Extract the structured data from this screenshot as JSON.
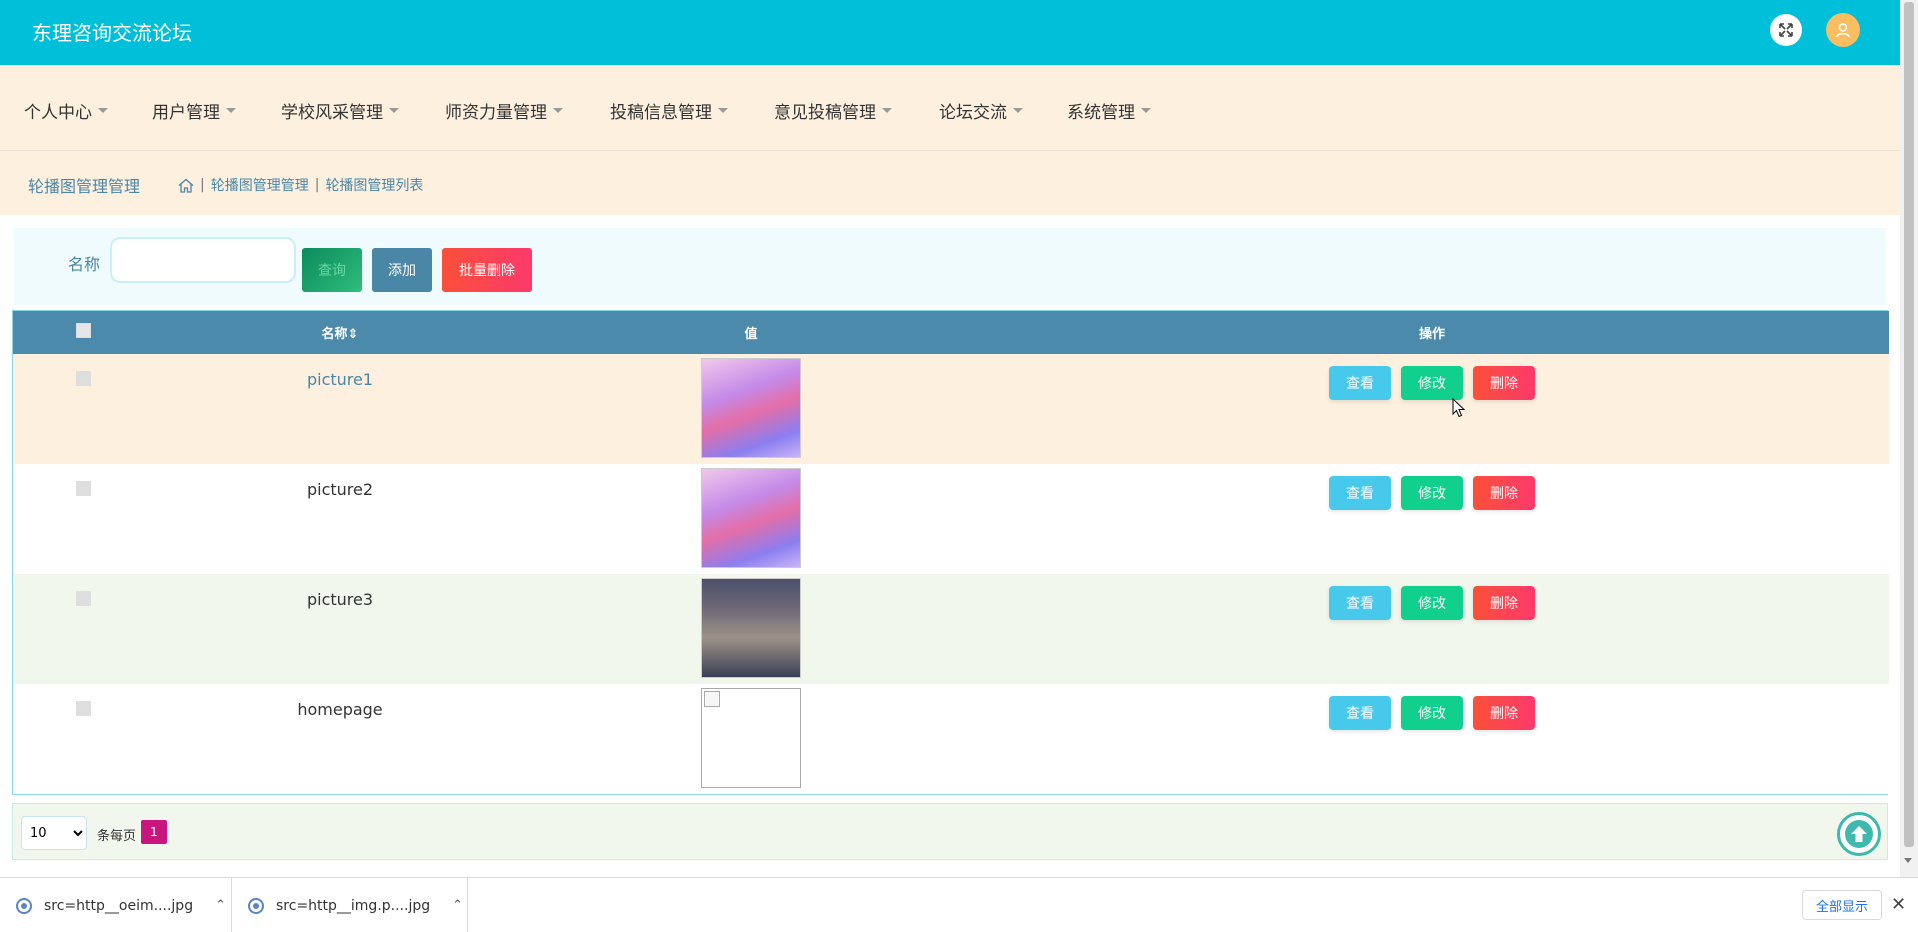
{
  "header": {
    "site_title": "东理咨询交流论坛"
  },
  "nav": {
    "items": [
      {
        "label": "个人中心"
      },
      {
        "label": "用户管理"
      },
      {
        "label": "学校风采管理"
      },
      {
        "label": "师资力量管理"
      },
      {
        "label": "投稿信息管理"
      },
      {
        "label": "意见投稿管理"
      },
      {
        "label": "论坛交流"
      },
      {
        "label": "系统管理"
      }
    ]
  },
  "breadcrumb": {
    "title": "轮播图管理管理",
    "path": [
      "轮播图管理管理",
      "轮播图管理列表"
    ],
    "separator": "|"
  },
  "search": {
    "label": "名称",
    "value": "",
    "placeholder": "",
    "search_button": "查询",
    "add_button": "添加",
    "batch_delete_button": "批量删除"
  },
  "table": {
    "columns": {
      "name": "名称",
      "sort": "⇕",
      "value": "值",
      "actions": "操作"
    },
    "action_labels": {
      "view": "查看",
      "edit": "修改",
      "delete": "删除"
    },
    "rows": [
      {
        "name": "picture1"
      },
      {
        "name": "picture2"
      },
      {
        "name": "picture3"
      },
      {
        "name": "homepage"
      }
    ]
  },
  "pagination": {
    "page_size": "10",
    "page_size_options": [
      "10"
    ],
    "per_page_label": "条每页",
    "current_page": "1"
  },
  "downloads": {
    "items": [
      {
        "filename": "src=http__oeim....jpg"
      },
      {
        "filename": "src=http__img.p....jpg"
      }
    ],
    "show_all": "全部显示",
    "close": "✕"
  },
  "colors": {
    "header": "#00c0d9",
    "nav_bg": "#fdf0df",
    "table_head": "#4b8aab",
    "view": "#47c9ec",
    "edit": "#11cf8c",
    "delete": "#fd3a6b",
    "page_active": "#c9167f"
  }
}
